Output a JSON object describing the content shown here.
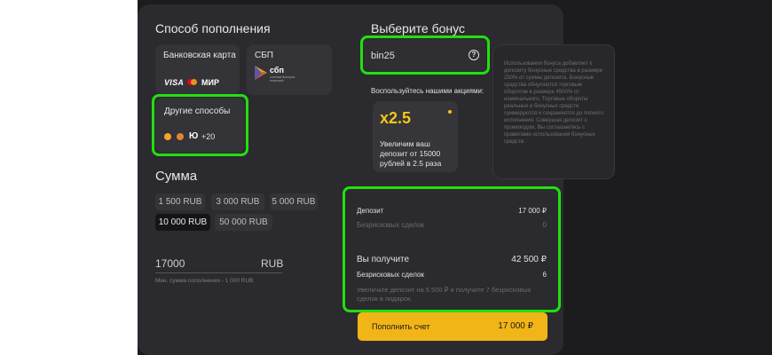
{
  "payment": {
    "title": "Способ пополнения",
    "bank_card": {
      "label": "Банковская карта",
      "visa": "VISA",
      "mir": "МИР"
    },
    "sbp": {
      "label": "СБП",
      "logo_text": "сбп",
      "logo_subtext": "система быстрых платежей"
    },
    "other": {
      "label": "Другие способы",
      "extra_count": "+20"
    }
  },
  "amount": {
    "title": "Сумма",
    "presets": [
      "1 500 RUB",
      "3 000 RUB",
      "5 000 RUB",
      "10 000 RUB",
      "50 000 RUB"
    ],
    "selected_preset": "10 000 RUB",
    "input_value": "17000",
    "currency": "RUB",
    "min_hint": "Мин. сумма пополнения - 1 000 RUB"
  },
  "bonus": {
    "title": "Выберите бонус",
    "code": "bin25",
    "promo_title": "Воспользуйтесь нашими акциями:",
    "promo_multiplier": "x2.5",
    "promo_text": "Увеличим ваш депозит от 15000 рублей в 2.5 раза",
    "tooltip": "Использовании бонуса добавляет к депозиту бонусные средства в размере 250% от суммы депозита. Бонусные средства обнуляются торговым оборотом в размере 4500% от номинального. Торговые обороты реальных и бонусных средств суммируются и сохраняются до полного исполнения. Совершая депозит с промокодом, Вы соглашаетесь с правилами использования бонусных средств."
  },
  "summary": {
    "deposit_label": "Депозит",
    "deposit_value": "17 000 ₽",
    "riskfree_label_dim": "Безрисковых сделок",
    "riskfree_value_dim": "0",
    "receive_label": "Вы получите",
    "receive_value": "42 500 ₽",
    "riskfree_label": "Безрисковых сделок",
    "riskfree_value": "6",
    "note": "Увеличьте депозит на 5 500 ₽ и получите 7 безрисковых сделок в подарок."
  },
  "topup": {
    "label": "Пополнить счет",
    "amount": "17 000 ₽"
  },
  "colors": {
    "accent_yellow": "#f2b517",
    "highlight_green": "#22e00f",
    "panel_bg": "#2b2b2f",
    "page_bg": "#1c1c1e"
  }
}
